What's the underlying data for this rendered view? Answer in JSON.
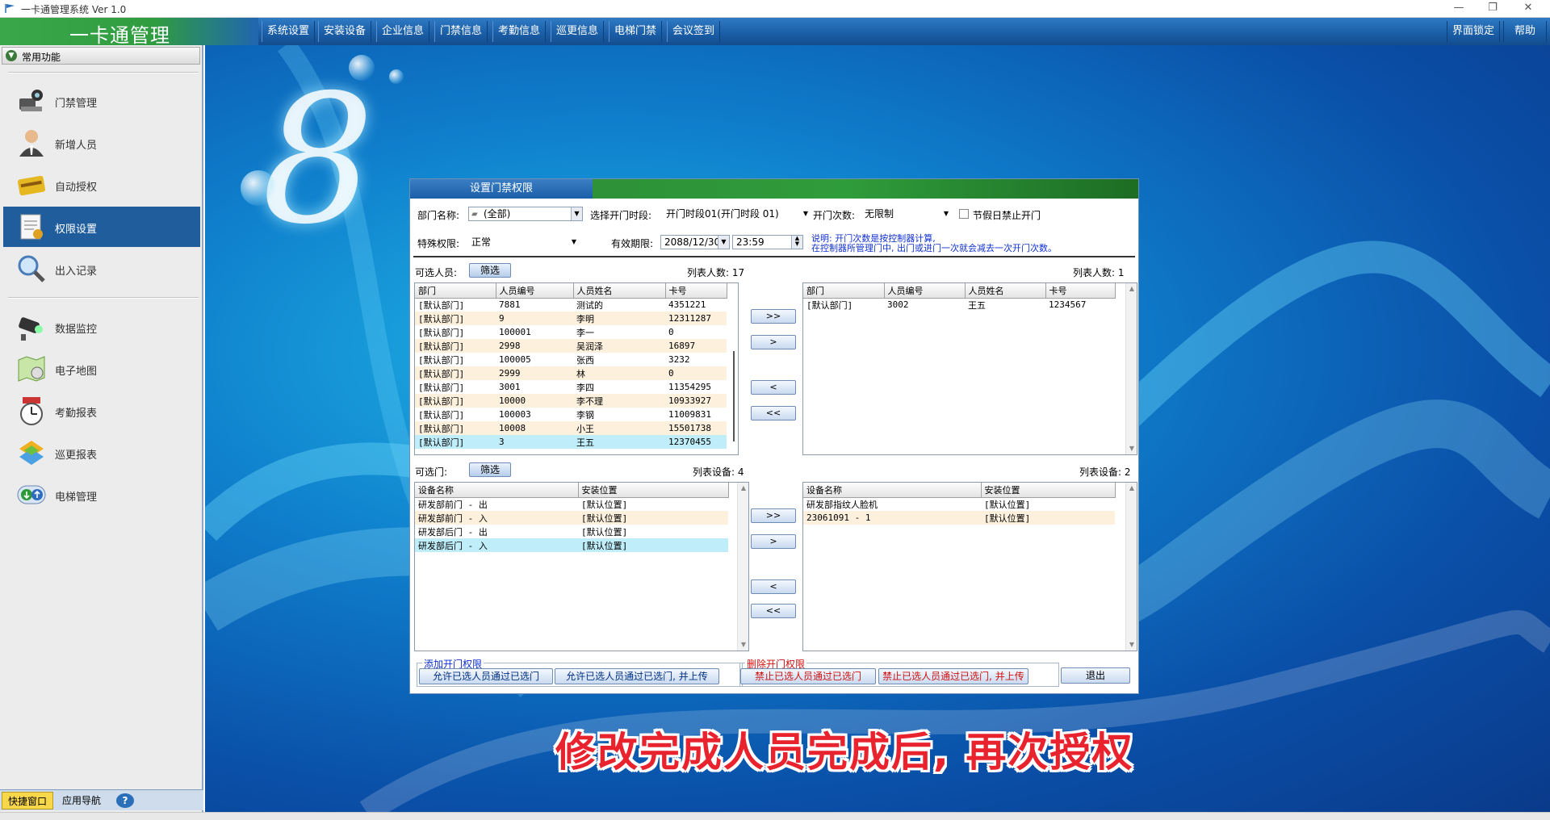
{
  "window": {
    "title": "一卡通管理系统 Ver 1.0",
    "minimize": "—",
    "restore": "❐",
    "close": "✕"
  },
  "brand": "一卡通管理",
  "menu": [
    "系统设置",
    "安装设备",
    "企业信息",
    "门禁信息",
    "考勤信息",
    "巡更信息",
    "电梯门禁",
    "会议签到"
  ],
  "menu_right": [
    "界面锁定",
    "帮助"
  ],
  "sidebar": {
    "header": "常用功能",
    "items": [
      {
        "label": "门禁管理",
        "icon": "door-access-icon"
      },
      {
        "label": "新增人员",
        "icon": "person-icon"
      },
      {
        "label": "自动授权",
        "icon": "card-icon"
      },
      {
        "label": "权限设置",
        "icon": "permission-doc-icon"
      },
      {
        "label": "出入记录",
        "icon": "magnifier-icon"
      },
      {
        "label": "数据监控",
        "icon": "camera-icon"
      },
      {
        "label": "电子地图",
        "icon": "map-icon"
      },
      {
        "label": "考勤报表",
        "icon": "clock-icon"
      },
      {
        "label": "巡更报表",
        "icon": "patrol-icon"
      },
      {
        "label": "电梯管理",
        "icon": "elevator-icon"
      }
    ],
    "tabs": [
      "快捷窗口",
      "应用导航",
      "?"
    ]
  },
  "dialog": {
    "title": "设置门禁权限",
    "dept_label": "部门名称:",
    "dept_value": "(全部)",
    "period_label": "选择开门时段:",
    "period_value": "开门时段01(开门时段 01)",
    "count_label": "开门次数:",
    "count_value": "无限制",
    "holiday_label": "节假日禁止开门",
    "special_label": "特殊权限:",
    "special_value": "正常",
    "valid_label": "有效期限:",
    "valid_date": "2088/12/30",
    "valid_time": "23:59",
    "note1": "说明: 开门次数是按控制器计算,",
    "note2": "在控制器所管理门中, 出门或进门一次就会减去一次开门次数。",
    "people_left_label": "可选人员:",
    "filter": "筛选",
    "people_left_count": "列表人数: 17",
    "people_right_count": "列表人数: 1",
    "people_columns": [
      "部门",
      "人员编号",
      "人员姓名",
      "卡号"
    ],
    "people_left": [
      [
        "[默认部门]",
        "7881",
        "测试的",
        "4351221"
      ],
      [
        "[默认部门]",
        "9",
        "李明",
        "12311287"
      ],
      [
        "[默认部门]",
        "100001",
        "李一",
        "0"
      ],
      [
        "[默认部门]",
        "2998",
        "吴润泽",
        "16897"
      ],
      [
        "[默认部门]",
        "100005",
        "张西",
        "3232"
      ],
      [
        "[默认部门]",
        "2999",
        "林",
        "0"
      ],
      [
        "[默认部门]",
        "3001",
        "李四",
        "11354295"
      ],
      [
        "[默认部门]",
        "10000",
        "李不理",
        "10933927"
      ],
      [
        "[默认部门]",
        "100003",
        "李钢",
        "11009831"
      ],
      [
        "[默认部门]",
        "10008",
        "小王",
        "15501738"
      ],
      [
        "[默认部门]",
        "3",
        "王五",
        "12370455"
      ]
    ],
    "people_right": [
      [
        "[默认部门]",
        "3002",
        "王五",
        "1234567"
      ]
    ],
    "doors_left_label": "可选门:",
    "doors_left_count": "列表设备: 4",
    "doors_right_count": "列表设备: 2",
    "door_columns": [
      "设备名称",
      "安装位置"
    ],
    "doors_left": [
      [
        "研发部前门 - 出",
        "[默认位置]"
      ],
      [
        "研发部前门 - 入",
        "[默认位置]"
      ],
      [
        "研发部后门 - 出",
        "[默认位置]"
      ],
      [
        "研发部后门 - 入",
        "[默认位置]"
      ]
    ],
    "doors_right": [
      [
        "研发部指纹人脸机",
        "[默认位置]"
      ],
      [
        "23061091 - 1",
        "[默认位置]"
      ]
    ],
    "arrows": [
      ">>",
      ">",
      "<",
      "<<"
    ],
    "add_group": "添加开门权限",
    "add_btn1": "允许已选人员通过已选门",
    "add_btn2": "允许已选人员通过已选门, 并上传",
    "del_group": "删除开门权限",
    "del_btn1": "禁止已选人员通过已选门",
    "del_btn2": "禁止已选人员通过已选门, 并上传",
    "exit": "退出"
  },
  "overlay_subtitle": "修改完成人员完成后, 再次授权",
  "colors": {
    "menu_blue": "#1b5fa8",
    "brand_green": "#3aa84a",
    "selected_row": "#bfeefa",
    "alt_row": "#fdf1dd",
    "subtitle_red": "#e8232e"
  }
}
